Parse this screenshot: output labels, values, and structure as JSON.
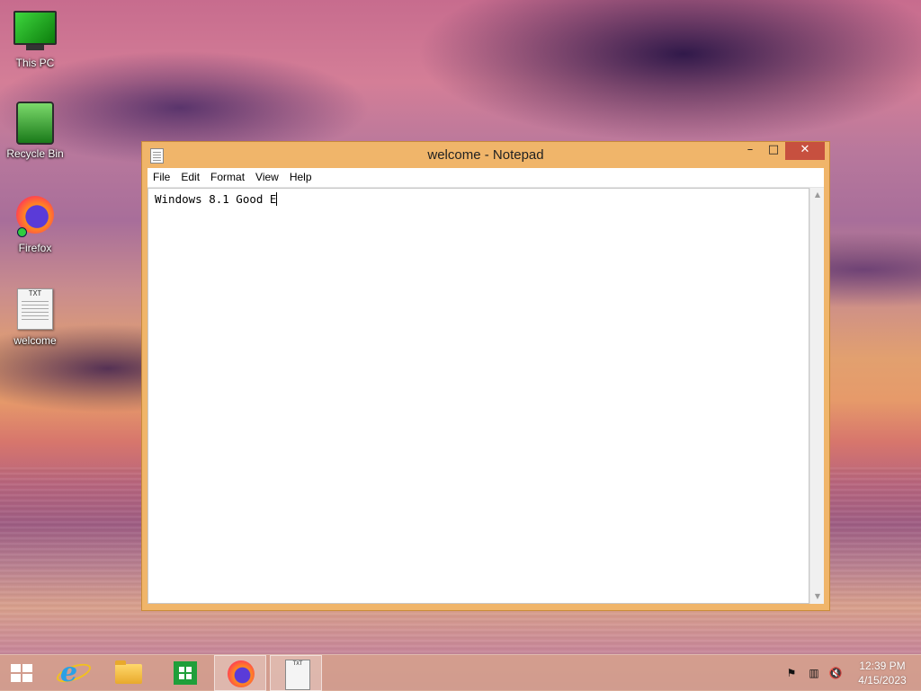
{
  "desktop": {
    "icons": [
      {
        "label": "This PC",
        "icon": "monitor-icon"
      },
      {
        "label": "Recycle Bin",
        "icon": "recycle-bin-icon"
      },
      {
        "label": "Firefox",
        "icon": "firefox-icon"
      },
      {
        "label": "welcome",
        "icon": "text-file-icon",
        "badge": "TXT"
      }
    ]
  },
  "window": {
    "title": "welcome - Notepad",
    "controls": {
      "minimize": "–",
      "maximize": "□",
      "close": "✕"
    },
    "menu": [
      "File",
      "Edit",
      "Format",
      "View",
      "Help"
    ],
    "content": "Windows 8.1 Good E"
  },
  "taskbar": {
    "items": [
      {
        "name": "start",
        "icon": "windows-logo-icon"
      },
      {
        "name": "internet-explorer",
        "icon": "ie-icon",
        "glyph": "e"
      },
      {
        "name": "file-explorer",
        "icon": "folder-icon"
      },
      {
        "name": "store",
        "icon": "store-icon"
      },
      {
        "name": "firefox",
        "icon": "firefox-icon",
        "active": true
      },
      {
        "name": "notepad",
        "icon": "text-file-icon",
        "badge": "TXT",
        "active": true
      }
    ],
    "tray": [
      {
        "icon": "flag-icon",
        "glyph": "⚑"
      },
      {
        "icon": "network-icon",
        "glyph": "▥"
      },
      {
        "icon": "volume-muted-icon",
        "glyph": "🔇"
      }
    ],
    "clock": {
      "time": "12:39 PM",
      "date": "4/15/2023"
    }
  },
  "colors": {
    "window_frame": "#f0b56a",
    "close_button": "#c7503f",
    "taskbar": "#d6a08c"
  }
}
